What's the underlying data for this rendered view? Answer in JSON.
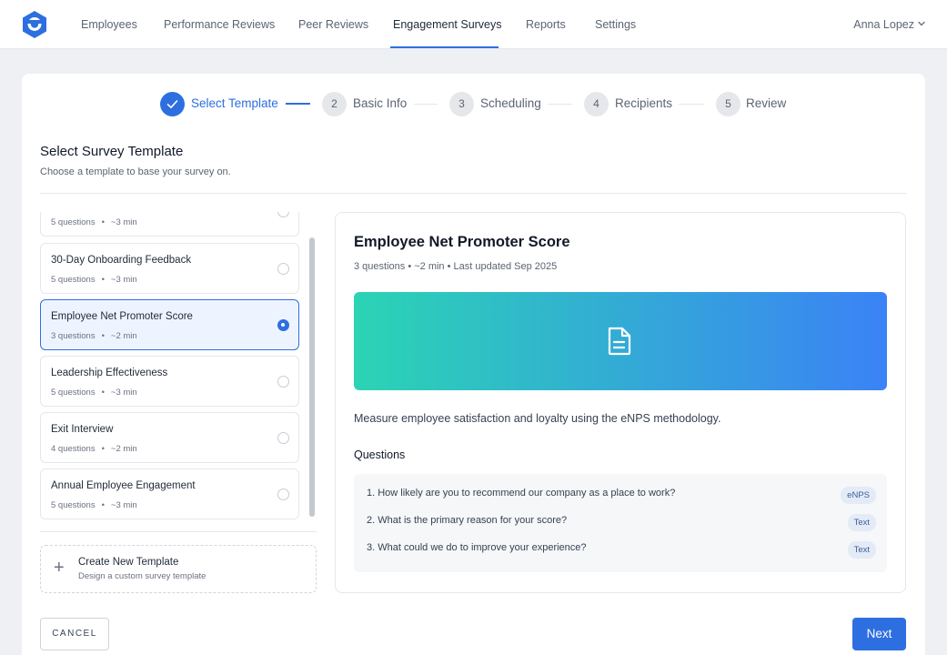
{
  "nav": {
    "items": [
      {
        "label": "Employees"
      },
      {
        "label": "Performance Reviews"
      },
      {
        "label": "Peer Reviews"
      },
      {
        "label": "Engagement Surveys"
      },
      {
        "label": "Reports"
      },
      {
        "label": "Settings"
      }
    ],
    "active_item": "Engagement Surveys",
    "user_name": "Anna Lopez"
  },
  "stepper": {
    "steps": [
      {
        "number": "1",
        "label": "Select Template",
        "state": "done"
      },
      {
        "number": "2",
        "label": "Basic Info",
        "state": "pending"
      },
      {
        "number": "3",
        "label": "Scheduling",
        "state": "pending"
      },
      {
        "number": "4",
        "label": "Recipients",
        "state": "pending"
      },
      {
        "number": "5",
        "label": "Review",
        "state": "pending"
      }
    ]
  },
  "section": {
    "title": "Select Survey Template",
    "subtitle": "Choose a template to base your survey on."
  },
  "templates": [
    {
      "name": "",
      "questions": "5 questions",
      "duration": "~3 min",
      "selected": false
    },
    {
      "name": "30-Day Onboarding Feedback",
      "questions": "5 questions",
      "duration": "~3 min",
      "selected": false
    },
    {
      "name": "Employee Net Promoter Score",
      "questions": "3 questions",
      "duration": "~2 min",
      "selected": true
    },
    {
      "name": "Leadership Effectiveness",
      "questions": "5 questions",
      "duration": "~3 min",
      "selected": false
    },
    {
      "name": "Exit Interview",
      "questions": "4 questions",
      "duration": "~2 min",
      "selected": false
    },
    {
      "name": "Annual Employee Engagement",
      "questions": "5 questions",
      "duration": "~3 min",
      "selected": false
    }
  ],
  "meta_separator": "•",
  "create_template": {
    "title": "Create New Template",
    "subtitle": "Design a custom survey template",
    "icon": "plus-icon"
  },
  "preview": {
    "title": "Employee Net Promoter Score",
    "meta": "3 questions • ~2 min • Last updated Sep 2025",
    "banner_icon": "document-icon",
    "banner_colors": [
      "#2bd4b4",
      "#3b82f6"
    ],
    "description": "Measure employee satisfaction and loyalty using the eNPS methodology.",
    "questions_heading": "Questions",
    "questions": [
      {
        "text": "1. How likely are you to recommend our company as a place to work?",
        "tag": "eNPS"
      },
      {
        "text": "2. What is the primary reason for your score?",
        "tag": "Text"
      },
      {
        "text": "3. What could we do to improve your experience?",
        "tag": "Text"
      }
    ]
  },
  "footer": {
    "cancel_label": "CANCEL",
    "next_label": "Next"
  },
  "colors": {
    "accent": "#2d6fe0",
    "page_bg": "#eef0f3"
  }
}
